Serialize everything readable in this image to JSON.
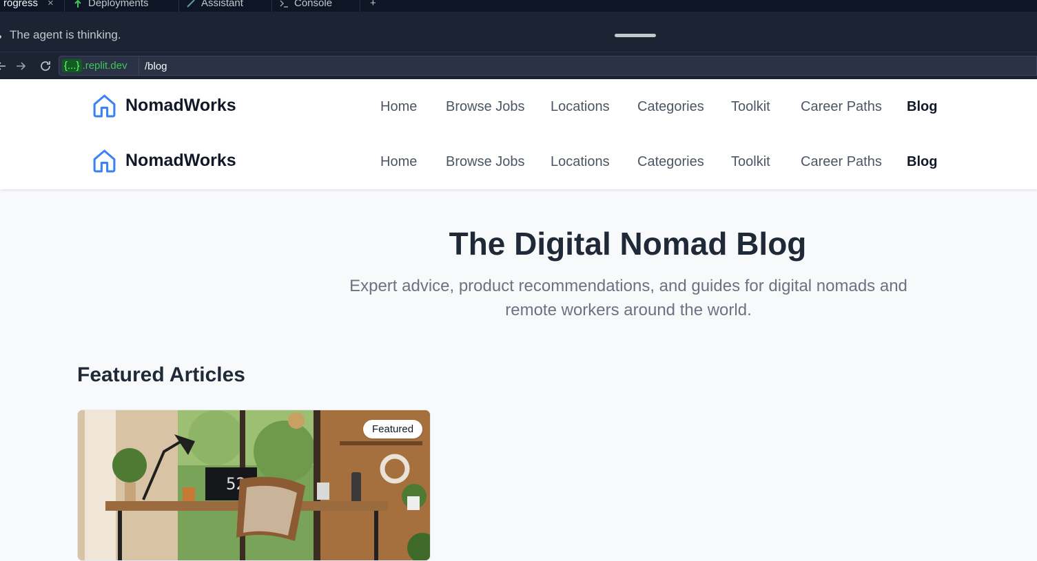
{
  "ide": {
    "tabs": [
      {
        "label": "rogress",
        "icon": "progress-icon"
      },
      {
        "label": "Deployments",
        "icon": "deploy-icon"
      },
      {
        "label": "Assistant",
        "icon": "assistant-icon"
      },
      {
        "label": "Console",
        "icon": "console-icon"
      }
    ],
    "close_glyph": "×",
    "add_glyph": "+",
    "agent_status": "The agent is thinking.",
    "url": {
      "chip": "{...}",
      "domain_suffix": ".replit.dev",
      "path": "/blog"
    }
  },
  "site": {
    "brand": "NomadWorks",
    "nav": [
      "Home",
      "Browse Jobs",
      "Locations",
      "Categories",
      "Toolkit",
      "Career Paths",
      "Blog"
    ],
    "active_nav": "Blog",
    "hero": {
      "title": "The Digital Nomad Blog",
      "subtitle": "Expert advice, product recommendations, and guides for digital nomads and remote workers around the world."
    },
    "featured": {
      "heading": "Featured Articles",
      "badge": "Featured",
      "monitor_text": "52"
    }
  },
  "colors": {
    "ide_bg": "#0e1525",
    "ide_panel": "#1c2333",
    "url_green": "#3fc55c",
    "brand_blue": "#3b82f6",
    "text_dark": "#1f2937",
    "text_muted": "#6b7280"
  }
}
